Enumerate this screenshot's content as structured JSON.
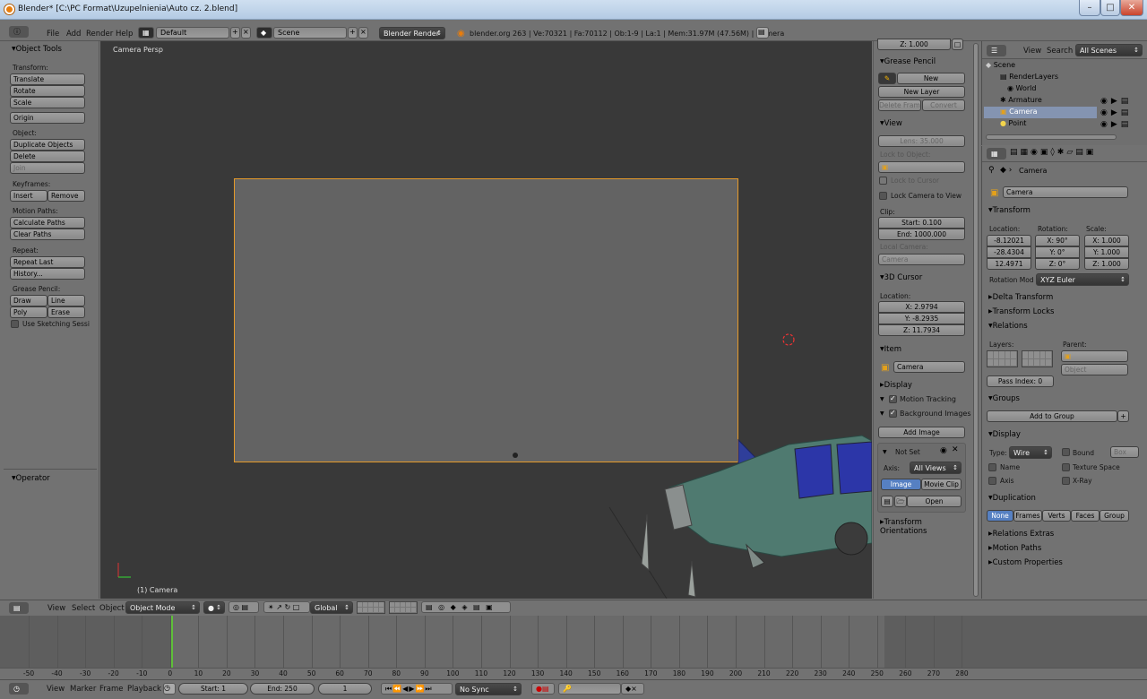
{
  "window": {
    "title": "Blender* [C:\\PC Format\\Uzupelnienia\\Auto cz. 2.blend]",
    "min": "–",
    "max": "□",
    "close": "✕"
  },
  "info_header": {
    "menus": [
      "File",
      "Add",
      "Render",
      "Help"
    ],
    "screen": "Default",
    "scene": "Scene",
    "engine": "Blender Render",
    "stats": "blender.org 263 | Ve:70321 | Fa:70112 | Ob:1-9 | La:1 | Mem:31.97M (47.56M) | Camera"
  },
  "toolshelf": {
    "title": "Object Tools",
    "transform_label": "Transform:",
    "translate": "Translate",
    "rotate": "Rotate",
    "scale": "Scale",
    "origin": "Origin",
    "object_label": "Object:",
    "duplicate": "Duplicate Objects",
    "delete": "Delete",
    "join": "Join",
    "keyframes_label": "Keyframes:",
    "insert": "Insert",
    "remove": "Remove",
    "motion_label": "Motion Paths:",
    "calc_paths": "Calculate Paths",
    "clear_paths": "Clear Paths",
    "repeat_label": "Repeat:",
    "repeat_last": "Repeat Last",
    "history": "History...",
    "gp_label": "Grease Pencil:",
    "draw": "Draw",
    "line": "Line",
    "poly": "Poly",
    "erase": "Erase",
    "sketching": "Use Sketching Sessi",
    "operator": "Operator"
  },
  "viewport": {
    "view_name": "Camera Persp",
    "object_name": "(1) Camera"
  },
  "npanel": {
    "zoom": "Z: 1.000",
    "grease_pencil": "Grease Pencil",
    "new": "New",
    "new_layer": "New Layer",
    "delete_frame": "Delete Frame",
    "convert": "Convert",
    "view": "View",
    "lens": "Lens: 35.000",
    "lock_to_object": "Lock to Object:",
    "lock_to_cursor": "Lock to Cursor",
    "lock_camera": "Lock Camera to View",
    "clip": "Clip:",
    "clip_start": "Start: 0.100",
    "clip_end": "End: 1000.000",
    "local_camera": "Local Camera:",
    "local_camera_val": "Camera",
    "cursor": "3D Cursor",
    "location": "Location:",
    "cx": "X: 2.9794",
    "cy": "Y: -8.2935",
    "cz": "Z: 11.7934",
    "item": "Item",
    "item_name": "Camera",
    "display": "Display",
    "motion_tracking": "Motion Tracking",
    "bg_images": "Background Images",
    "add_image": "Add Image",
    "not_set": "Not Set",
    "axis": "Axis:",
    "axis_val": "All Views",
    "image": "Image",
    "movie_clip": "Movie Clip",
    "open": "Open",
    "transform_orient": "Transform Orientations"
  },
  "outliner": {
    "view": "View",
    "search": "Search",
    "filter": "All Scenes",
    "items": [
      "Scene",
      "RenderLayers",
      "World",
      "Armature",
      "Camera",
      "Point"
    ]
  },
  "properties": {
    "breadcrumb": "Camera",
    "name": "Camera",
    "transform": "Transform",
    "location": "Location:",
    "rotation": "Rotation:",
    "scale": "Scale:",
    "loc": [
      "-8.12021",
      "-28.4304",
      "12.4971"
    ],
    "rot": [
      "X: 90°",
      "Y: 0°",
      "Z: 0°"
    ],
    "scl": [
      "X: 1.000",
      "Y: 1.000",
      "Z: 1.000"
    ],
    "rotation_mode_label": "Rotation Mod",
    "rotation_mode": "XYZ Euler",
    "delta": "Delta Transform",
    "locks": "Transform Locks",
    "relations": "Relations",
    "layers": "Layers:",
    "parent": "Parent:",
    "parent_type": "Object",
    "pass_index": "Pass Index: 0",
    "groups": "Groups",
    "add_group": "Add to Group",
    "display": "Display",
    "type_label": "Type:",
    "type_val": "Wire",
    "bound": "Bound",
    "bound_type": "Box",
    "name_chk": "Name",
    "texture_space": "Texture Space",
    "axis_chk": "Axis",
    "xray": "X-Ray",
    "duplication": "Duplication",
    "dup_modes": [
      "None",
      "Frames",
      "Verts",
      "Faces",
      "Group"
    ],
    "rel_extras": "Relations Extras",
    "motion_paths": "Motion Paths",
    "custom_props": "Custom Properties"
  },
  "view3d_header": {
    "menus": [
      "View",
      "Select",
      "Object"
    ],
    "mode": "Object Mode",
    "orientation": "Global"
  },
  "timeline": {
    "ticks": [
      "-50",
      "-40",
      "-30",
      "-20",
      "-10",
      "0",
      "10",
      "20",
      "30",
      "40",
      "50",
      "60",
      "70",
      "80",
      "90",
      "100",
      "110",
      "120",
      "130",
      "140",
      "150",
      "160",
      "170",
      "180",
      "190",
      "200",
      "210",
      "220",
      "230",
      "240",
      "250",
      "260",
      "270",
      "280"
    ],
    "menus": [
      "View",
      "Marker",
      "Frame",
      "Playback"
    ],
    "start": "Start: 1",
    "end": "End: 250",
    "current": "1",
    "sync": "No Sync"
  }
}
